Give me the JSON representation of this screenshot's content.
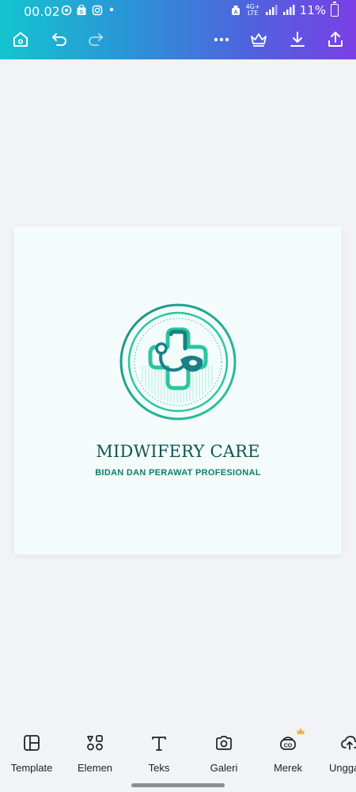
{
  "status_bar": {
    "time": "00.02",
    "network_top": "4G+",
    "network_bottom": "LTE",
    "battery": "11%"
  },
  "toolbar": {
    "icons": [
      "home-icon",
      "undo-icon",
      "redo-icon",
      "more-icon",
      "crown-icon",
      "download-icon",
      "share-icon"
    ]
  },
  "design": {
    "title": "MIDWIFERY CARE",
    "subtitle": "BIDAN DAN PERAWAT PROFESIONAL",
    "colors": {
      "primary": "#0f5452",
      "accent": "#2bc6a0",
      "teal": "#1a7f86"
    }
  },
  "bottom_nav": {
    "items": [
      {
        "label": "Template",
        "icon": "template-icon"
      },
      {
        "label": "Elemen",
        "icon": "elements-icon"
      },
      {
        "label": "Teks",
        "icon": "text-icon"
      },
      {
        "label": "Galeri",
        "icon": "camera-icon"
      },
      {
        "label": "Merek",
        "icon": "brand-icon"
      },
      {
        "label": "Unggah",
        "icon": "upload-icon"
      }
    ]
  }
}
